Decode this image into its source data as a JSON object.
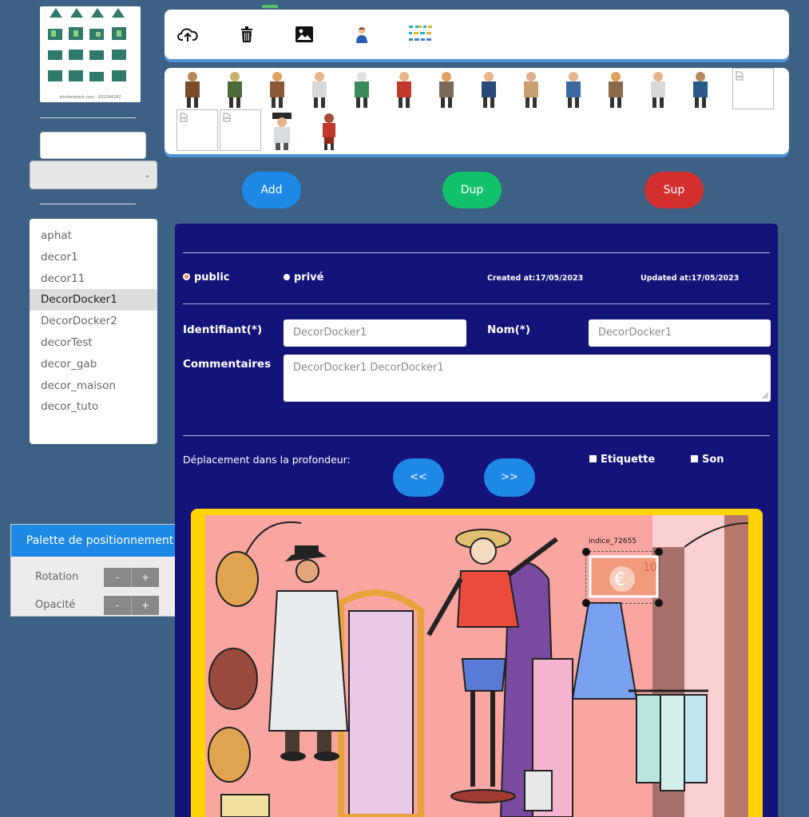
{
  "thumbnail": {
    "caption": "shutterstock.com · 432244282"
  },
  "left": {
    "search_value": "",
    "select_value": "",
    "decors": [
      {
        "label": "aphat",
        "active": false
      },
      {
        "label": "decor1",
        "active": false
      },
      {
        "label": "decor11",
        "active": false
      },
      {
        "label": "DecorDocker1",
        "active": true
      },
      {
        "label": "DecorDocker2",
        "active": false
      },
      {
        "label": "decorTest",
        "active": false
      },
      {
        "label": "decor_gab",
        "active": false
      },
      {
        "label": "decor_maison",
        "active": false
      },
      {
        "label": "decor_tuto",
        "active": false
      }
    ]
  },
  "palette": {
    "title": "Palette de positionnement",
    "rotation_label": "Rotation",
    "opacity_label": "Opacité",
    "minus": "-",
    "plus": "+"
  },
  "toolbar": {
    "icons": [
      "cloud-upload-icon",
      "trash-icon",
      "image-icon",
      "person-icon",
      "glyph-grid-icon"
    ]
  },
  "actions": {
    "add": "Add",
    "dup": "Dup",
    "sup": "Sup"
  },
  "colors": {
    "add": "#1e88e5",
    "dup": "#12c26a",
    "sup": "#d32f2f",
    "panel": "#13137a",
    "frame": "#ffd400"
  },
  "form": {
    "public_label": "public",
    "private_label": "privé",
    "created": "Created at:17/05/2023",
    "updated": "Updated at:17/05/2023",
    "id_label": "Identifiant(*)",
    "id_value": "DecorDocker1",
    "name_label": "Nom(*)",
    "name_value": "DecorDocker1",
    "comments_label": "Commentaires",
    "comments_value": "DecorDocker1 DecorDocker1",
    "depth_label": "Déplacement dans la profondeur:",
    "back_label": "<<",
    "forward_label": ">>",
    "etiquette_label": "Etiquette",
    "son_label": "Son"
  },
  "scene": {
    "selected_label": "indice_72655"
  }
}
